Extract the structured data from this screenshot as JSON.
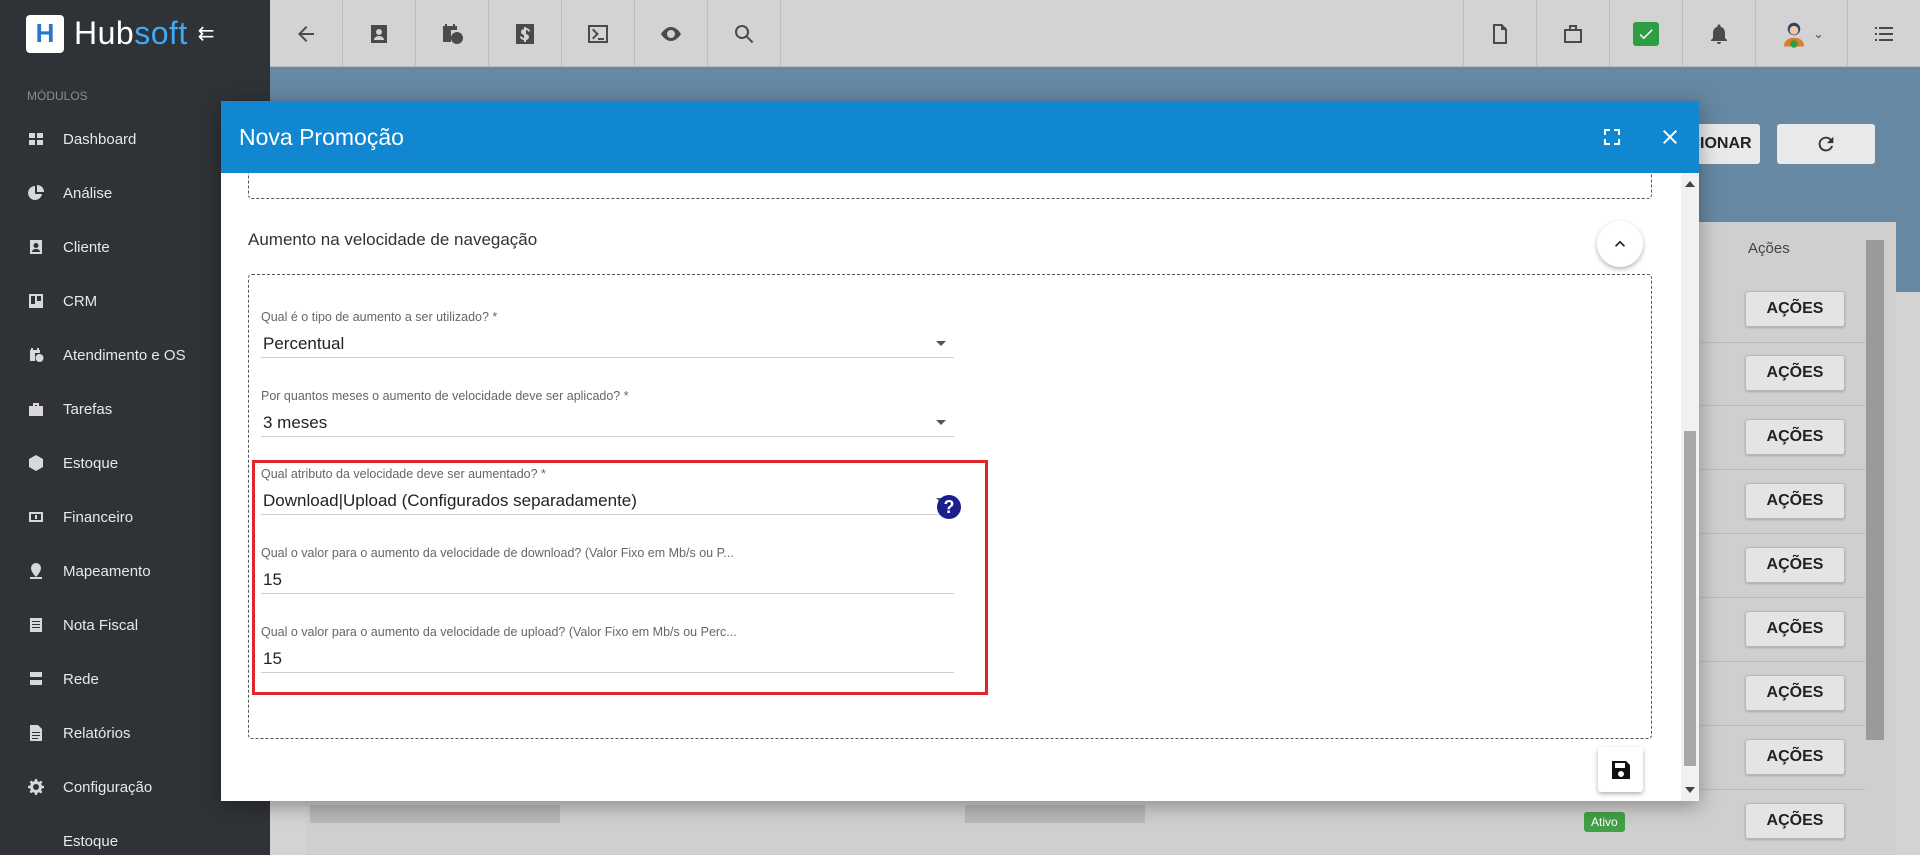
{
  "brand": {
    "name_part1": "Hub",
    "name_part2": "soft"
  },
  "sidebar": {
    "modules_label": "MÓDULOS",
    "items": [
      {
        "label": "Dashboard",
        "icon": "grid-icon"
      },
      {
        "label": "Análise",
        "icon": "pie-chart-icon"
      },
      {
        "label": "Cliente",
        "icon": "contact-card-icon"
      },
      {
        "label": "CRM",
        "icon": "kanban-icon"
      },
      {
        "label": "Atendimento e OS",
        "icon": "calendar-clock-icon"
      },
      {
        "label": "Tarefas",
        "icon": "briefcase-icon"
      },
      {
        "label": "Estoque",
        "icon": "box-icon"
      },
      {
        "label": "Financeiro",
        "icon": "money-icon"
      },
      {
        "label": "Mapeamento",
        "icon": "map-pin-icon"
      },
      {
        "label": "Nota Fiscal",
        "icon": "document-icon"
      },
      {
        "label": "Rede",
        "icon": "network-icon"
      },
      {
        "label": "Relatórios",
        "icon": "report-icon"
      },
      {
        "label": "Configuração",
        "icon": "gear-icon"
      },
      {
        "label": "Estoque",
        "icon": "box-icon"
      }
    ]
  },
  "background": {
    "actions_header": "Ações",
    "top_button_partial": "CIONAR",
    "action_label": "AÇÕES",
    "status_badge": "Ativo"
  },
  "modal": {
    "title": "Nova Promoção",
    "section_title": "Aumento na velocidade de navegação",
    "fields": {
      "tipo_aumento": {
        "label": "Qual é o tipo de aumento a ser utilizado? *",
        "value": "Percentual"
      },
      "meses": {
        "label": "Por quantos meses o aumento de velocidade deve ser aplicado? *",
        "value": "3 meses"
      },
      "atributo": {
        "label": "Qual atributo da velocidade deve ser aumentado? *",
        "value": "Download|Upload (Configurados separadamente)"
      },
      "download": {
        "label": "Qual o valor para o aumento da velocidade de download? (Valor Fixo em Mb/s ou P...",
        "value": "15"
      },
      "upload": {
        "label": "Qual o valor para o aumento da velocidade de upload? (Valor Fixo em Mb/s ou Perc...",
        "value": "15"
      }
    },
    "help_glyph": "?"
  },
  "colors": {
    "modal_header": "#1187d1",
    "highlight": "#e0262a",
    "sidebar_bg": "#2f3237",
    "status_green": "#43a047"
  }
}
